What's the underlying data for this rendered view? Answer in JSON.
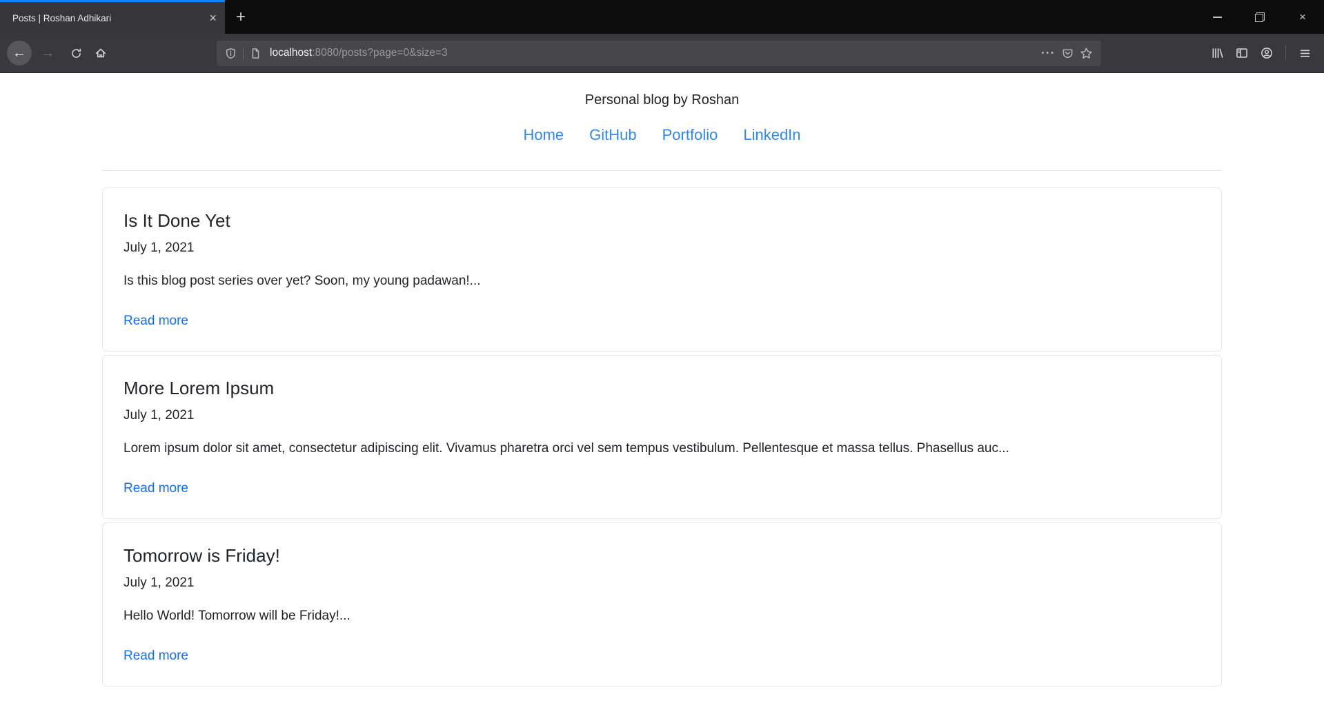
{
  "theme": {
    "accent-blue": "#0a84ff",
    "titlebar-bg": "#0c0c0d",
    "toolbar-bg": "#38383d",
    "urlbar-bg": "#474749",
    "nav-link": "#2e87f3",
    "read-more-link": "#0d6efd"
  },
  "browser": {
    "tab_title": "Posts | Roshan Adhikari",
    "url_host": "localhost",
    "url_rest": ":8080/posts?page=0&size=3"
  },
  "icons": {
    "close": "×",
    "new_tab": "+",
    "back": "←",
    "forward": "→",
    "overflow_dots": "•••"
  },
  "page": {
    "site_title": "Personal blog by Roshan",
    "nav": [
      {
        "label": "Home"
      },
      {
        "label": "GitHub"
      },
      {
        "label": "Portfolio"
      },
      {
        "label": "LinkedIn"
      }
    ],
    "read_more_label": "Read more",
    "posts": [
      {
        "title": "Is It Done Yet",
        "date": "July 1, 2021",
        "excerpt": "Is this blog post series over yet? Soon, my young padawan!..."
      },
      {
        "title": "More Lorem Ipsum",
        "date": "July 1, 2021",
        "excerpt": "Lorem ipsum dolor sit amet, consectetur adipiscing elit. Vivamus pharetra orci vel sem tempus vestibulum. Pellentesque et massa tellus. Phasellus auc..."
      },
      {
        "title": "Tomorrow is Friday!",
        "date": "July 1, 2021",
        "excerpt": "Hello World! Tomorrow will be Friday!..."
      }
    ]
  }
}
